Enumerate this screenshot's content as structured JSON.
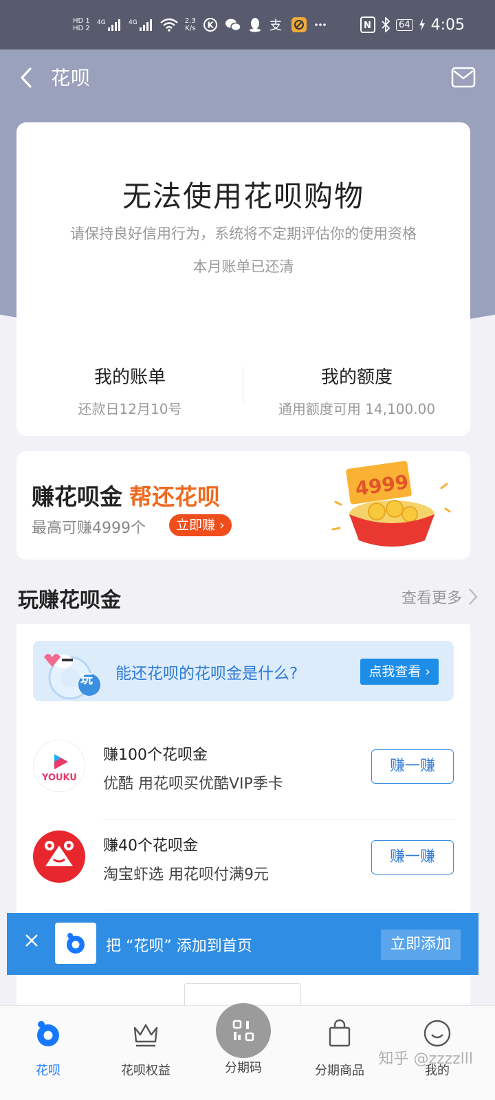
{
  "status_bar": {
    "hd1": "HD 1",
    "hd2": "HD 2",
    "net1": "4G",
    "net2": "4G",
    "speed_value": "2.3",
    "speed_unit": "K/s",
    "battery": "64",
    "time": "4:05",
    "icons": [
      "signal-icon",
      "wifi-icon",
      "k-app-icon",
      "wechat-icon",
      "qq-icon",
      "alipay-icon",
      "app-notify-icon",
      "more-dots-icon",
      "nfc-icon",
      "bluetooth-icon",
      "charging-icon"
    ]
  },
  "nav": {
    "title": "花呗",
    "back_icon": "back-arrow-icon",
    "mail_icon": "mail-icon"
  },
  "main_card": {
    "headline": "无法使用花呗购物",
    "description": "请保持良好信用行为，系统将不定期评估你的使用资格",
    "status": "本月账单已还清",
    "bill": {
      "title": "我的账单",
      "subtitle": "还款日12月10号"
    },
    "limit": {
      "title": "我的额度",
      "subtitle": "通用额度可用 14,100.00"
    }
  },
  "promo": {
    "title": "赚花呗金",
    "accent": "帮还花呗",
    "subtitle": "最高可赚4999个",
    "button": "立即赚",
    "art_number": "4999"
  },
  "section": {
    "title": "玩赚花呗金",
    "more": "查看更多"
  },
  "info_banner": {
    "badge": "玩",
    "text": "能还花呗的花呗金是什么?",
    "button": "点我查看"
  },
  "tasks": [
    {
      "title": "赚100个花呗金",
      "subtitle": "优酷 用花呗买优酷VIP季卡",
      "button": "赚一赚",
      "logo_text": "YOUKU"
    },
    {
      "title": "赚40个花呗金",
      "subtitle": "淘宝虾选 用花呗付满9元",
      "button": "赚一赚",
      "logo_text": ""
    }
  ],
  "add_banner": {
    "text": "把 “花呗” 添加到首页",
    "button": "立即添加"
  },
  "bottom_nav": [
    {
      "label": "花呗",
      "active": true
    },
    {
      "label": "花呗权益",
      "active": false
    },
    {
      "label": "分期码",
      "active": false
    },
    {
      "label": "分期商品",
      "active": false
    },
    {
      "label": "我的",
      "active": false
    }
  ],
  "watermark": "知乎 @zzzzlll",
  "colors": {
    "hero": "#9aa1bc",
    "primary_blue": "#2f8de4",
    "orange": "#ef6a1e"
  }
}
